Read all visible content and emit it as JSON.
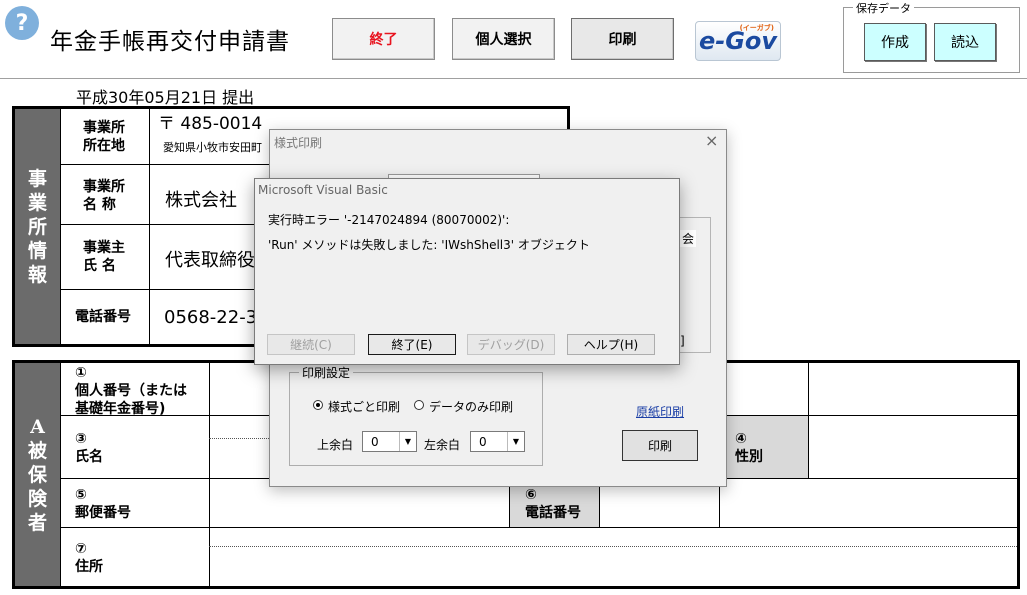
{
  "header": {
    "help_icon": "?",
    "title": "年金手帳再交付申請書",
    "buttons": {
      "quit": "終了",
      "select_person": "個人選択",
      "print": "印刷"
    },
    "logo": {
      "text": "e-Gov",
      "subtitle": "(イーガブ)"
    },
    "save_data": {
      "legend": "保存データ",
      "create": "作成",
      "load": "読込"
    }
  },
  "date_line": "平成30年05月21日 提出",
  "business_section": {
    "sidebar_label": "事業所情報",
    "fields": {
      "address_label": [
        "事業所",
        "所在地"
      ],
      "postal": "〒 485-0014",
      "address": "愛知県小牧市安田町",
      "name_label": [
        "事業所",
        "名 称"
      ],
      "company": "株式会社",
      "owner_label": [
        "事業主",
        "氏 名"
      ],
      "owner": "代表取締役",
      "phone_label": "電話番号",
      "phone": "0568-22-3"
    }
  },
  "insured_section": {
    "sidebar_label": "A被保険者",
    "fields": {
      "f1_num": "①",
      "f1_label": [
        "個人番号（または",
        "基礎年金番号)"
      ],
      "f3_num": "③",
      "f3_label": "氏名",
      "f4_num": "④",
      "f4_label": "性別",
      "f5_num": "⑤",
      "f5_label": "郵便番号",
      "f6_num": "⑥",
      "f6_label": "電話番号",
      "f7_num": "⑦",
      "f7_label": "住所"
    }
  },
  "print_dialog": {
    "title": "様式印刷",
    "close": "×",
    "partial_text": "会",
    "partial_text2": "]",
    "settings_legend": "印刷設定",
    "radio_form": "様式ごと印刷",
    "radio_data": "データのみ印刷",
    "top_margin_label": "上余白",
    "top_margin_value": "0",
    "left_margin_label": "左余白",
    "left_margin_value": "0",
    "original_print_link": "原紙印刷",
    "print_button": "印刷"
  },
  "vb_dialog": {
    "title": "Microsoft Visual Basic",
    "error_line": "実行時エラー '-2147024894 (80070002)':",
    "message": "'Run' メソッドは失敗しました: 'IWshShell3' オブジェクト",
    "buttons": {
      "continue": "継続(C)",
      "end": "終了(E)",
      "debug": "デバッグ(D)",
      "help": "ヘルプ(H)"
    }
  }
}
